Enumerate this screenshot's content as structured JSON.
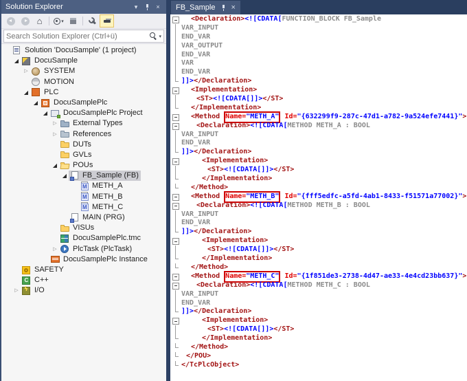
{
  "solution_explorer": {
    "title": "Solution Explorer",
    "title_icons": [
      "chevron-down",
      "pin",
      "close"
    ],
    "selection_color": "#CDCDD3",
    "toolbar": {
      "buttons": [
        "back",
        "forward",
        "home",
        "switch-views",
        "collapse-all",
        "properties",
        "preview-selected-items"
      ],
      "active_button": "preview-selected-items",
      "active_highlight": "#FDF4BF"
    },
    "search": {
      "placeholder": "Search Solution Explorer (Ctrl+ü)",
      "value": ""
    },
    "tree": [
      {
        "depth": 0,
        "exp": "none",
        "icon": "solution",
        "label": "Solution 'DocuSample' (1 project)"
      },
      {
        "depth": 1,
        "exp": "open",
        "icon": "tcproject",
        "label": "DocuSample"
      },
      {
        "depth": 2,
        "exp": "closed",
        "icon": "system",
        "label": "SYSTEM"
      },
      {
        "depth": 2,
        "exp": "none",
        "icon": "motion",
        "label": "MOTION"
      },
      {
        "depth": 2,
        "exp": "open",
        "icon": "plc",
        "label": "PLC"
      },
      {
        "depth": 3,
        "exp": "open",
        "icon": "plcproj",
        "label": "DocuSamplePlc"
      },
      {
        "depth": 4,
        "exp": "open",
        "icon": "project",
        "label": "DocuSamplePlc Project"
      },
      {
        "depth": 5,
        "exp": "closed",
        "icon": "exttypes",
        "label": "External Types"
      },
      {
        "depth": 5,
        "exp": "closed",
        "icon": "references",
        "label": "References"
      },
      {
        "depth": 5,
        "exp": "none",
        "icon": "folder",
        "label": "DUTs"
      },
      {
        "depth": 5,
        "exp": "none",
        "icon": "folder",
        "label": "GVLs"
      },
      {
        "depth": 5,
        "exp": "open",
        "icon": "folder-open",
        "label": "POUs"
      },
      {
        "depth": 6,
        "exp": "open",
        "icon": "pou",
        "label": "FB_Sample (FB)",
        "selected": true
      },
      {
        "depth": 7,
        "exp": "none",
        "icon": "method",
        "label": "METH_A"
      },
      {
        "depth": 7,
        "exp": "none",
        "icon": "method",
        "label": "METH_B"
      },
      {
        "depth": 7,
        "exp": "none",
        "icon": "method",
        "label": "METH_C"
      },
      {
        "depth": 6,
        "exp": "none",
        "icon": "prg",
        "label": "MAIN (PRG)"
      },
      {
        "depth": 5,
        "exp": "none",
        "icon": "folder",
        "label": "VISUs"
      },
      {
        "depth": 5,
        "exp": "none",
        "icon": "tmc",
        "label": "DocuSamplePlc.tmc"
      },
      {
        "depth": 5,
        "exp": "closed",
        "icon": "plctask",
        "label": "PlcTask (PlcTask)"
      },
      {
        "depth": 4,
        "exp": "none",
        "icon": "instance",
        "label": "DocuSamplePlc Instance"
      },
      {
        "depth": 1,
        "exp": "none",
        "icon": "safety",
        "label": "SAFETY"
      },
      {
        "depth": 1,
        "exp": "none",
        "icon": "cpp",
        "label": "C++"
      },
      {
        "depth": 1,
        "exp": "closed",
        "icon": "io",
        "label": "I/O"
      }
    ]
  },
  "editor": {
    "tab": {
      "label": "FB_Sample",
      "icons": [
        "pin",
        "close"
      ]
    },
    "colors": {
      "tag": "#A31515",
      "attr": "#E00000",
      "value": "#0000FF",
      "cdata": "#0000FF",
      "plain": "#8B8B8B",
      "highlight_box": "#CC0000",
      "background": "#FFFFFF",
      "tabstrip": "#2A3E5F",
      "tab": "#46597B"
    },
    "lines": [
      {
        "i": 14,
        "f": "b",
        "s": [
          [
            "g",
            "<Declaration>"
          ],
          [
            "c",
            "<![CDATA["
          ],
          [
            "t",
            "FUNCTION_BLOCK FB_Sample"
          ]
        ]
      },
      {
        "i": 0,
        "f": "l",
        "s": [
          [
            "t",
            "VAR_INPUT"
          ]
        ]
      },
      {
        "i": 0,
        "f": "l",
        "s": [
          [
            "t",
            "END_VAR"
          ]
        ]
      },
      {
        "i": 0,
        "f": "l",
        "s": [
          [
            "t",
            "VAR_OUTPUT"
          ]
        ]
      },
      {
        "i": 0,
        "f": "l",
        "s": [
          [
            "t",
            "END_VAR"
          ]
        ]
      },
      {
        "i": 0,
        "f": "l",
        "s": [
          [
            "t",
            "VAR"
          ]
        ]
      },
      {
        "i": 0,
        "f": "l",
        "s": [
          [
            "t",
            "END_VAR"
          ]
        ]
      },
      {
        "i": 0,
        "f": "e",
        "s": [
          [
            "c",
            "]]>"
          ],
          [
            "g",
            "</Declaration>"
          ]
        ]
      },
      {
        "i": 14,
        "f": "b",
        "s": [
          [
            "g",
            "<Implementation>"
          ]
        ]
      },
      {
        "i": 22,
        "f": "l",
        "s": [
          [
            "g",
            "<ST>"
          ],
          [
            "c",
            "<![CDATA[]]>"
          ],
          [
            "g",
            "</ST>"
          ]
        ]
      },
      {
        "i": 14,
        "f": "e",
        "s": [
          [
            "g",
            "</Implementation>"
          ]
        ]
      },
      {
        "i": 14,
        "f": "b",
        "s": [
          [
            "g",
            "<Method "
          ],
          [
            "B",
            [
              [
                "a",
                "Name="
              ],
              [
                "v",
                "\"METH_A\""
              ]
            ]
          ],
          [
            "g",
            " "
          ],
          [
            "a",
            "Id="
          ],
          [
            "v",
            "\"{632299f9-287c-47d1-a782-9a524efe7441}\""
          ],
          [
            "g",
            ">"
          ]
        ]
      },
      {
        "i": 22,
        "f": "b",
        "s": [
          [
            "g",
            "<Declaration>"
          ],
          [
            "c",
            "<![CDATA["
          ],
          [
            "t",
            "METHOD METH_A : BOOL"
          ]
        ]
      },
      {
        "i": 0,
        "f": "l",
        "s": [
          [
            "t",
            "VAR_INPUT"
          ]
        ]
      },
      {
        "i": 0,
        "f": "l",
        "s": [
          [
            "t",
            "END_VAR"
          ]
        ]
      },
      {
        "i": 0,
        "f": "e",
        "s": [
          [
            "c",
            "]]>"
          ],
          [
            "g",
            "</Declaration>"
          ]
        ]
      },
      {
        "i": 30,
        "f": "b",
        "s": [
          [
            "g",
            "<Implementation>"
          ]
        ]
      },
      {
        "i": 38,
        "f": "l",
        "s": [
          [
            "g",
            "<ST>"
          ],
          [
            "c",
            "<![CDATA[]]>"
          ],
          [
            "g",
            "</ST>"
          ]
        ]
      },
      {
        "i": 30,
        "f": "e",
        "s": [
          [
            "g",
            "</Implementation>"
          ]
        ]
      },
      {
        "i": 14,
        "f": "e",
        "s": [
          [
            "g",
            "</Method>"
          ]
        ]
      },
      {
        "i": 14,
        "f": "b",
        "s": [
          [
            "g",
            "<Method "
          ],
          [
            "B",
            [
              [
                "a",
                "Name="
              ],
              [
                "v",
                "\"METH_B\""
              ]
            ]
          ],
          [
            "g",
            " "
          ],
          [
            "a",
            "Id="
          ],
          [
            "v",
            "\"{fff5edfc-a5fd-4ab1-8433-f51571a77002}\""
          ],
          [
            "g",
            ">"
          ]
        ]
      },
      {
        "i": 22,
        "f": "b",
        "s": [
          [
            "g",
            "<Declaration>"
          ],
          [
            "c",
            "<![CDATA["
          ],
          [
            "t",
            "METHOD METH_B : BOOL"
          ]
        ]
      },
      {
        "i": 0,
        "f": "l",
        "s": [
          [
            "t",
            "VAR_INPUT"
          ]
        ]
      },
      {
        "i": 0,
        "f": "l",
        "s": [
          [
            "t",
            "END_VAR"
          ]
        ]
      },
      {
        "i": 0,
        "f": "e",
        "s": [
          [
            "c",
            "]]>"
          ],
          [
            "g",
            "</Declaration>"
          ]
        ]
      },
      {
        "i": 30,
        "f": "b",
        "s": [
          [
            "g",
            "<Implementation>"
          ]
        ]
      },
      {
        "i": 38,
        "f": "l",
        "s": [
          [
            "g",
            "<ST>"
          ],
          [
            "c",
            "<![CDATA[]]>"
          ],
          [
            "g",
            "</ST>"
          ]
        ]
      },
      {
        "i": 30,
        "f": "e",
        "s": [
          [
            "g",
            "</Implementation>"
          ]
        ]
      },
      {
        "i": 14,
        "f": "e",
        "s": [
          [
            "g",
            "</Method>"
          ]
        ]
      },
      {
        "i": 14,
        "f": "b",
        "s": [
          [
            "g",
            "<Method "
          ],
          [
            "B",
            [
              [
                "a",
                "Name="
              ],
              [
                "v",
                "\"METH_C\""
              ]
            ]
          ],
          [
            "g",
            " "
          ],
          [
            "a",
            "Id="
          ],
          [
            "v",
            "\"{1f851de3-2738-4d47-ae33-4e4cd23bb637}\""
          ],
          [
            "g",
            ">"
          ]
        ]
      },
      {
        "i": 22,
        "f": "b",
        "s": [
          [
            "g",
            "<Declaration>"
          ],
          [
            "c",
            "<![CDATA["
          ],
          [
            "t",
            "METHOD METH_C : BOOL"
          ]
        ]
      },
      {
        "i": 0,
        "f": "l",
        "s": [
          [
            "t",
            "VAR_INPUT"
          ]
        ]
      },
      {
        "i": 0,
        "f": "l",
        "s": [
          [
            "t",
            "END_VAR"
          ]
        ]
      },
      {
        "i": 0,
        "f": "e",
        "s": [
          [
            "c",
            "]]>"
          ],
          [
            "g",
            "</Declaration>"
          ]
        ]
      },
      {
        "i": 30,
        "f": "b",
        "s": [
          [
            "g",
            "<Implementation>"
          ]
        ]
      },
      {
        "i": 38,
        "f": "l",
        "s": [
          [
            "g",
            "<ST>"
          ],
          [
            "c",
            "<![CDATA[]]>"
          ],
          [
            "g",
            "</ST>"
          ]
        ]
      },
      {
        "i": 30,
        "f": "e",
        "s": [
          [
            "g",
            "</Implementation>"
          ]
        ]
      },
      {
        "i": 14,
        "f": "e",
        "s": [
          [
            "g",
            "</Method>"
          ]
        ]
      },
      {
        "i": 7,
        "f": "e",
        "s": [
          [
            "g",
            "</POU>"
          ]
        ]
      },
      {
        "i": 0,
        "f": "e",
        "s": [
          [
            "g",
            "</TcPlcObject>"
          ]
        ]
      }
    ]
  }
}
